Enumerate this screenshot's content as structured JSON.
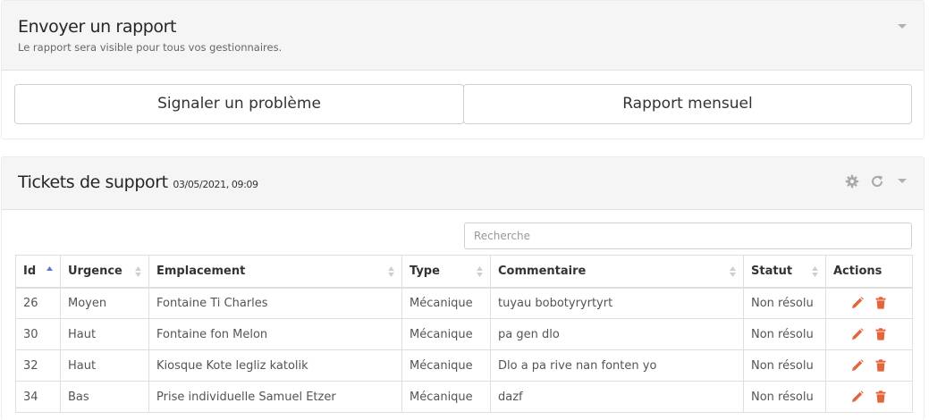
{
  "report_panel": {
    "title": "Envoyer un rapport",
    "subtitle": "Le rapport sera visible pour tous vos gestionnaires.",
    "buttons": [
      "Signaler un problème",
      "Rapport mensuel"
    ]
  },
  "tickets_panel": {
    "title": "Tickets de support",
    "timestamp": "03/05/2021, 09:09",
    "search_placeholder": "Recherche",
    "columns": [
      "Id",
      "Urgence",
      "Emplacement",
      "Type",
      "Commentaire",
      "Statut",
      "Actions"
    ],
    "rows": [
      [
        "26",
        "Moyen",
        "Fontaine Ti Charles",
        "Mécanique",
        "tuyau bobotyryrtyrt",
        "Non résolu"
      ],
      [
        "30",
        "Haut",
        "Fontaine fon Melon",
        "Mécanique",
        "pa gen dlo",
        "Non résolu"
      ],
      [
        "32",
        "Haut",
        "Kiosque Kote legliz katolik",
        "Mécanique",
        "Dlo a pa rive nan fonten yo",
        "Non résolu"
      ],
      [
        "34",
        "Bas",
        "Prise individuelle Samuel Etzer",
        "Mécanique",
        "dazf",
        "Non résolu"
      ]
    ]
  },
  "icons": [
    "chevron-down-icon",
    "gear-icon",
    "refresh-icon",
    "sort-icon",
    "pencil-icon",
    "trash-icon"
  ],
  "colors": {
    "action": "#e4643b",
    "header_bg": "#f5f5f5",
    "sort_active": "#5b72d8"
  }
}
